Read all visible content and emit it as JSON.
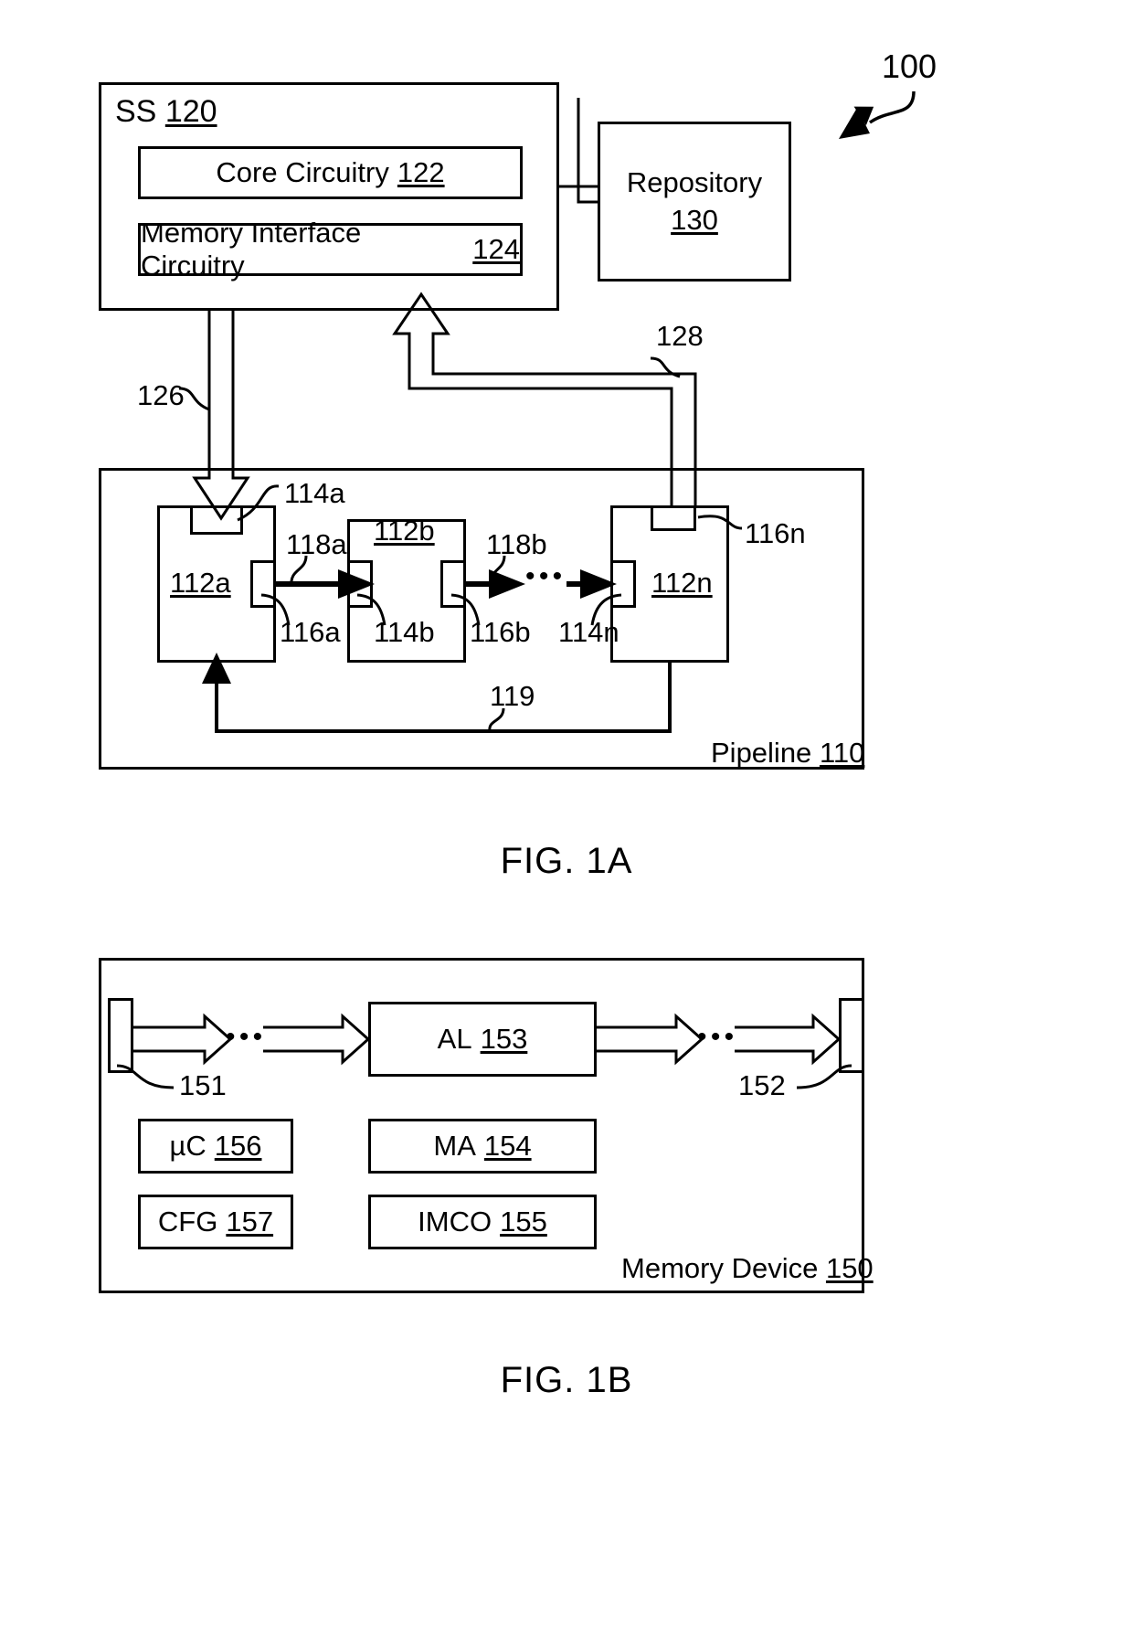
{
  "figures": [
    {
      "caption": "FIG. 1A",
      "system_ref": "100",
      "blocks": {
        "ss": {
          "label": "SS",
          "ref": "120"
        },
        "core": {
          "label": "Core Circuitry",
          "ref": "122"
        },
        "memif": {
          "label": "Memory Interface Circuitry",
          "ref": "124"
        },
        "repository": {
          "label": "Repository",
          "ref": "130"
        },
        "pipeline": {
          "label": "Pipeline",
          "ref": "110"
        },
        "stage_a": {
          "ref": "112a"
        },
        "stage_b": {
          "ref": "112b"
        },
        "stage_n": {
          "ref": "112n"
        }
      },
      "callouts": {
        "c114a": "114a",
        "c116a": "116a",
        "c114b": "114b",
        "c116b": "116b",
        "c114n": "114n",
        "c116n": "116n",
        "c118a": "118a",
        "c118b": "118b",
        "c119": "119",
        "c126": "126",
        "c128": "128"
      },
      "ellipsis": "• • •"
    },
    {
      "caption": "FIG. 1B",
      "blocks": {
        "device": {
          "label": "Memory Device",
          "ref": "150"
        },
        "al": {
          "label": "AL",
          "ref": "153"
        },
        "uc": {
          "label": "µC",
          "ref": "156"
        },
        "cfg": {
          "label": "CFG",
          "ref": "157"
        },
        "ma": {
          "label": "MA",
          "ref": "154"
        },
        "imco": {
          "label": "IMCO",
          "ref": "155"
        }
      },
      "callouts": {
        "c151": "151",
        "c152": "152"
      },
      "ellipsis": "• • •"
    }
  ]
}
